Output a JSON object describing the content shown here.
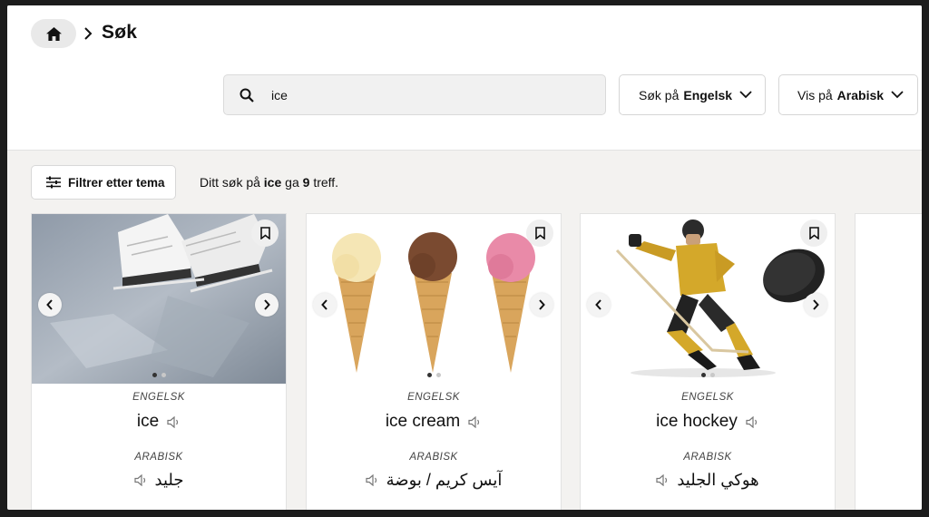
{
  "breadcrumb": {
    "home_icon": "home-icon",
    "separator_icon": "chevron-right-icon",
    "title": "Søk"
  },
  "search": {
    "value": "ice",
    "placeholder": ""
  },
  "search_lang": {
    "label": "Søk på",
    "value": "Engelsk"
  },
  "display_lang": {
    "label": "Vis på",
    "value": "Arabisk"
  },
  "filter": {
    "label": "Filtrer etter tema"
  },
  "results": {
    "prefix": "Ditt søk på",
    "term": "ice",
    "middle": "ga",
    "count": "9",
    "suffix": "treff."
  },
  "cards": [
    {
      "src_lang": "ENGELSK",
      "word": "ice",
      "tgt_lang": "ARABISK",
      "translation": "جليد"
    },
    {
      "src_lang": "ENGELSK",
      "word": "ice cream",
      "tgt_lang": "ARABISK",
      "translation": "آيس كريم / بوضة"
    },
    {
      "src_lang": "ENGELSK",
      "word": "ice hockey",
      "tgt_lang": "ARABISK",
      "translation": "هوكي الجليد"
    }
  ],
  "colors": {
    "accent": "#111111",
    "panel": "#f3f2f0",
    "pill": "#e9e9e9"
  }
}
